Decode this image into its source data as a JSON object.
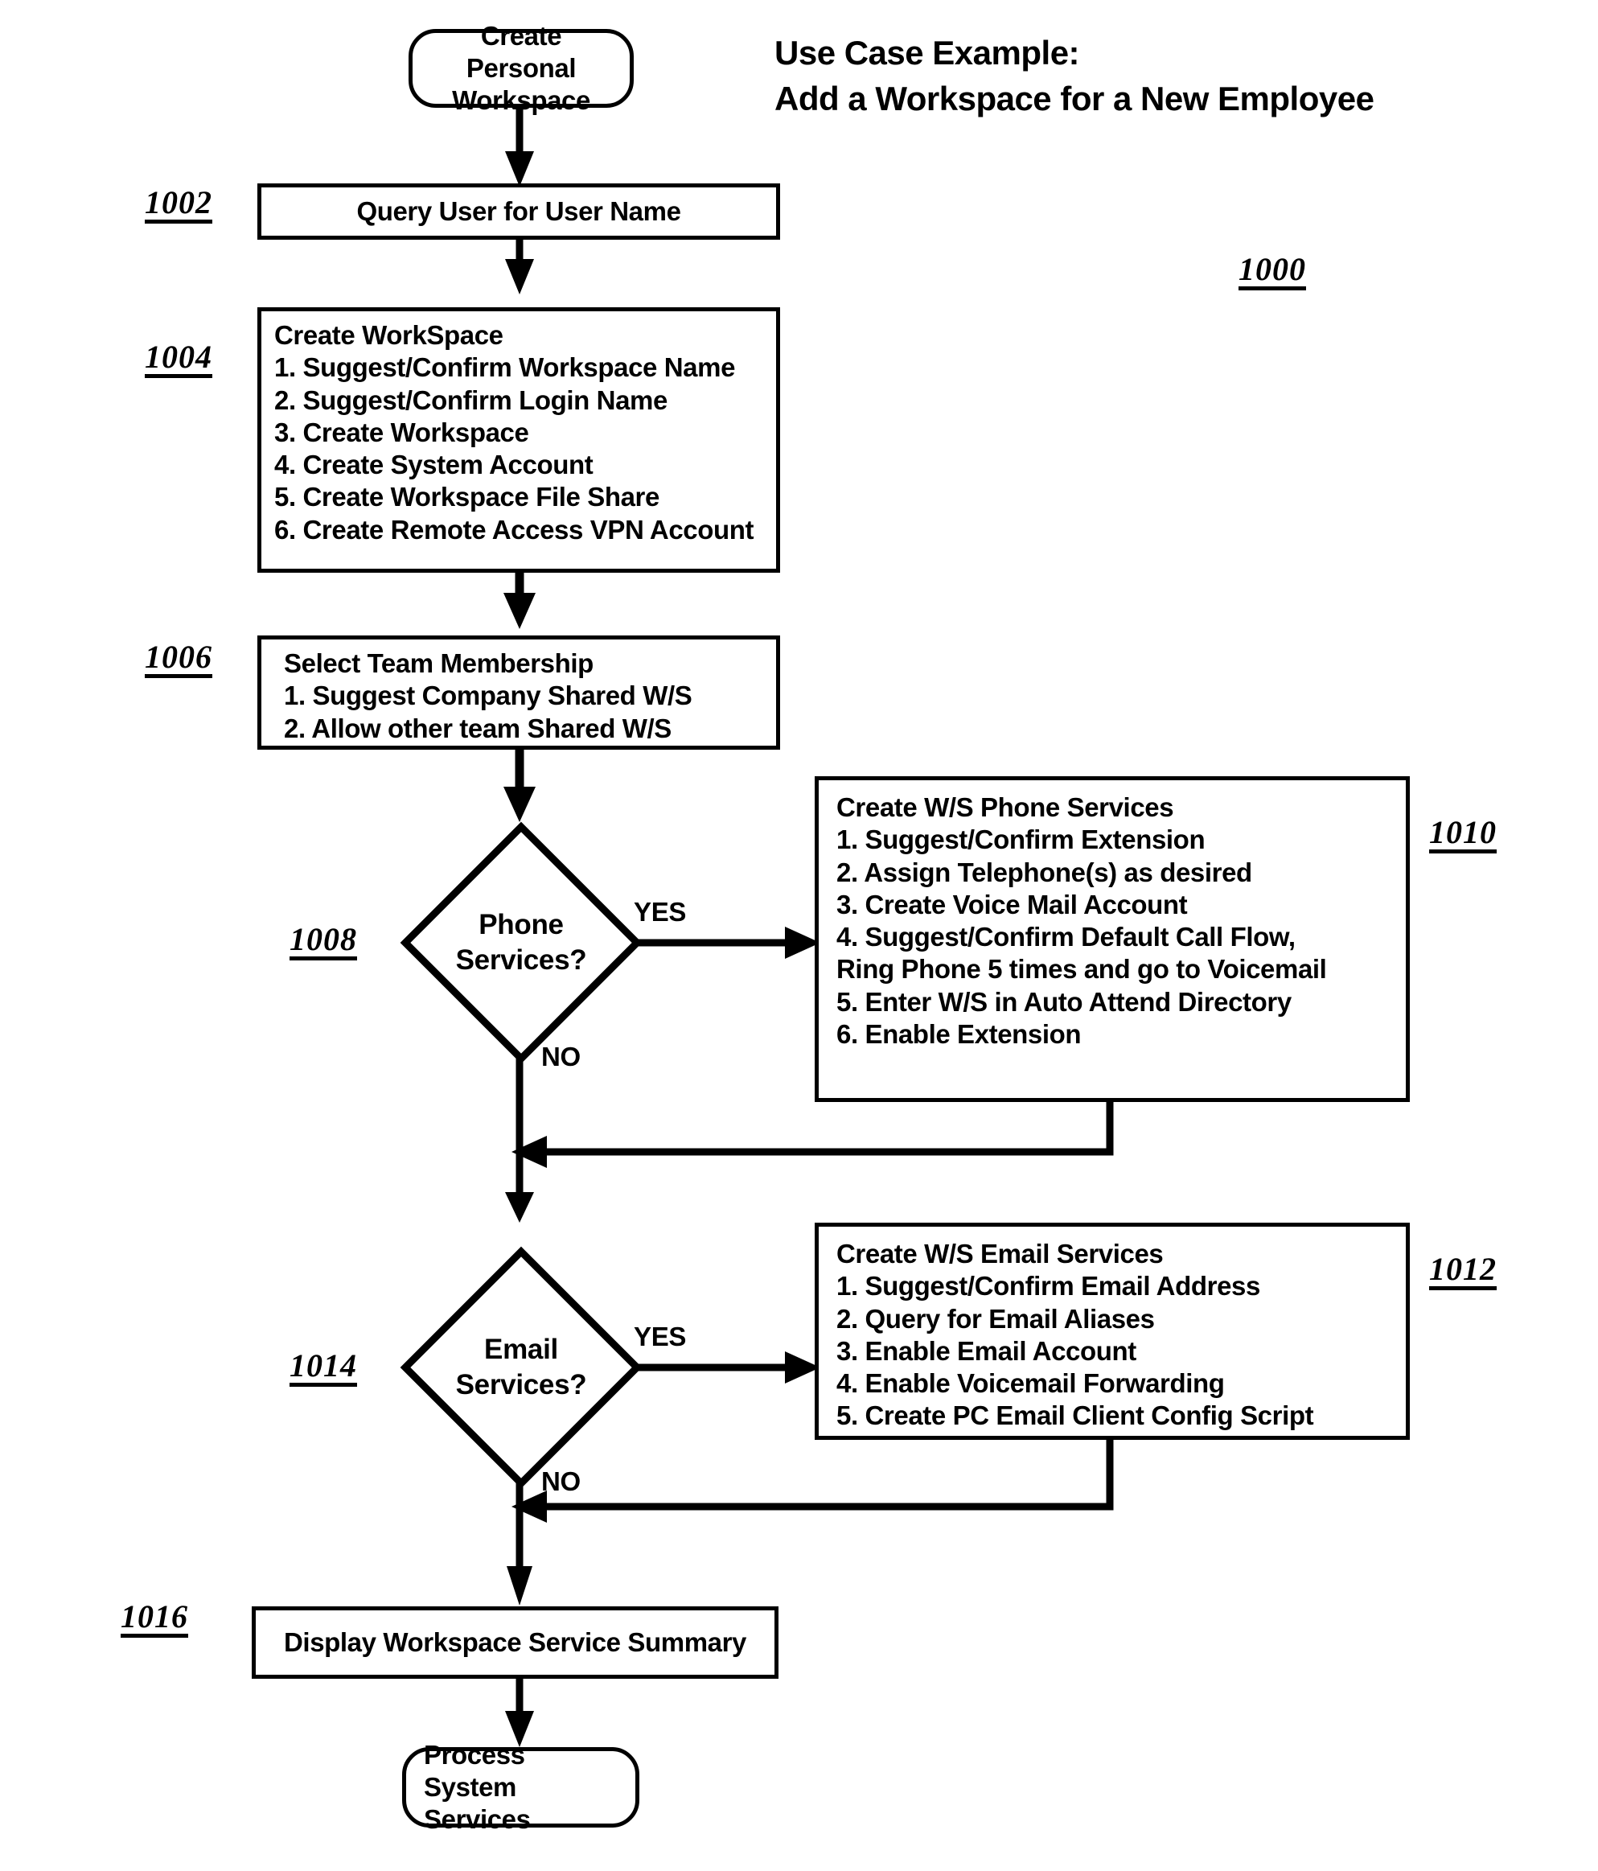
{
  "diagram": {
    "headline": "Use Case Example:\nAdd a Workspace for a New Employee",
    "figure_ref": "1000",
    "yes_label_phone": "YES",
    "no_label_phone": "NO",
    "yes_label_email": "YES",
    "no_label_email": "NO"
  },
  "nodes": {
    "start": {
      "ref": "",
      "text": "Create Personal\nWorkspace"
    },
    "query_user": {
      "ref": "1002",
      "text": "Query User for User Name"
    },
    "create_workspace": {
      "ref": "1004",
      "title": "Create WorkSpace",
      "steps": [
        "1.  Suggest/Confirm Workspace Name",
        "2.  Suggest/Confirm Login Name",
        "3.  Create Workspace",
        "4.  Create System Account",
        "5.  Create Workspace File Share",
        "6.  Create Remote Access VPN Account"
      ]
    },
    "select_team": {
      "ref": "1006",
      "title": "Select Team Membership",
      "steps": [
        "1.  Suggest Company Shared W/S",
        "2.  Allow other team Shared W/S"
      ]
    },
    "phone_decision": {
      "ref": "1008",
      "text": "Phone\nServices?"
    },
    "phone_services": {
      "ref": "1010",
      "title": "Create W/S Phone Services",
      "steps": [
        "1.  Suggest/Confirm Extension",
        "2.  Assign Telephone(s) as desired",
        "3.  Create Voice Mail Account",
        "4.  Suggest/Confirm  Default Call Flow,",
        "Ring Phone 5 times and go to Voicemail",
        "5.  Enter W/S in Auto Attend Directory",
        "6.  Enable Extension"
      ]
    },
    "email_decision": {
      "ref": "1014",
      "text": "Email\nServices?"
    },
    "email_services": {
      "ref": "1012",
      "title": "Create W/S Email Services",
      "steps": [
        "1.  Suggest/Confirm Email Address",
        "2.  Query for Email Aliases",
        "3.  Enable Email Account",
        "4.  Enable Voicemail Forwarding",
        "5.  Create PC Email Client Config Script"
      ]
    },
    "summary": {
      "ref": "1016",
      "text": "Display Workspace Service Summary"
    },
    "end": {
      "ref": "",
      "text": "Process System\nServices"
    }
  }
}
